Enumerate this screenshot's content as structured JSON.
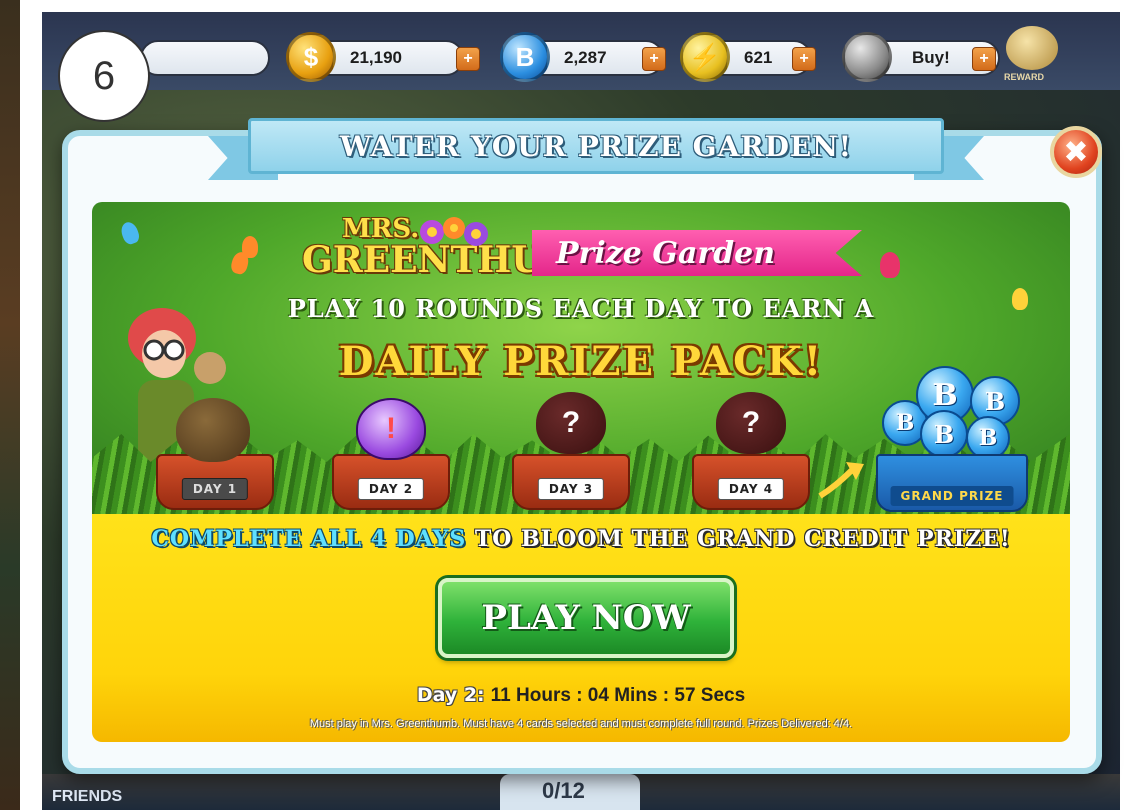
{
  "step_badge": "6",
  "topbar": {
    "coins": "21,190",
    "bingo_bucks": "2,287",
    "energy": "621",
    "buy_label": "Buy!",
    "reward_label": "REWARD",
    "coin_symbol": "$",
    "bucks_symbol": "B",
    "energy_symbol": "⚡",
    "plus_symbol": "+"
  },
  "dialog": {
    "title": "WATER YOUR PRIZE GARDEN!",
    "close_symbol": "✖",
    "logo_line1": "MRS.",
    "logo_line2": "GREENTHUMB",
    "prize_banner": "Prize Garden",
    "headline1": "PLAY 10 ROUNDS EACH DAY TO EARN A",
    "headline2": "DAILY PRIZE PACK!",
    "days": [
      {
        "label": "DAY 1",
        "plant": ""
      },
      {
        "label": "DAY 2",
        "plant": "!"
      },
      {
        "label": "DAY 3",
        "plant": "?"
      },
      {
        "label": "DAY 4",
        "plant": "?"
      }
    ],
    "grand_prize_label": "GRAND PRIZE",
    "grand_ball_letter": "B",
    "complete_part1": "COMPLETE ALL 4 DAYS",
    "complete_part2": "TO BLOOM THE GRAND CREDIT PRIZE!",
    "play_button": "PLAY NOW",
    "timer_day": "Day 2:",
    "timer_value": "11 Hours : 04 Mins : 57 Secs",
    "fineprint": "Must play in Mrs. Greenthumb. Must have 4 cards selected and must complete full round. Prizes Delivered: 4/4."
  },
  "background": {
    "friends_label": "FRIENDS",
    "search_text": "0/12"
  },
  "colors": {
    "ribbon": "#8fd2ea",
    "garden_green": "#4fa82a",
    "yellow_panel": "#ffd40a",
    "play_button": "#2fb23a",
    "cyan_text": "#5fe0ff"
  }
}
